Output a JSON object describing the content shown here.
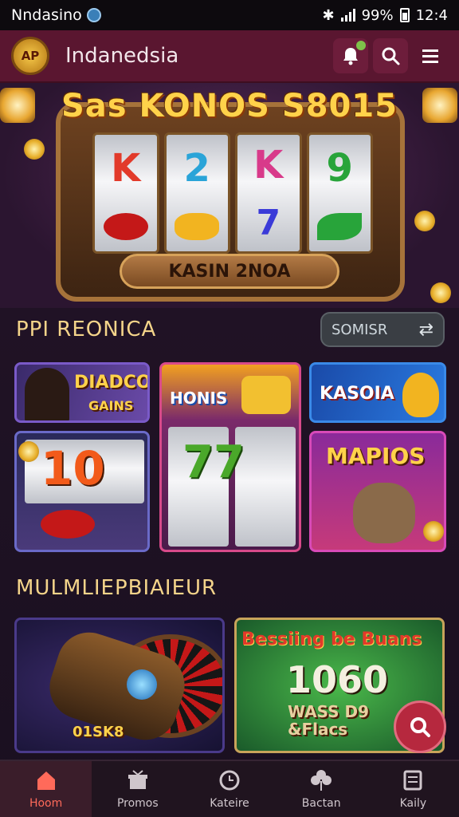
{
  "status_bar": {
    "carrier": "Nndasino",
    "battery": "99%",
    "time": "12:4"
  },
  "header": {
    "logo_text": "AP",
    "title": "Indanedsia"
  },
  "hero": {
    "title": "Sas KONOS S8015",
    "reel_symbols": [
      "K",
      "2",
      "K",
      "9"
    ],
    "plaque": "KASIN 2NOA"
  },
  "section_popular": {
    "title": "PPI REONICA",
    "sort_label": "SOMISR",
    "tiles": [
      {
        "label": "DIADCO",
        "sub": "GAINS"
      },
      {
        "label": "HONIS"
      },
      {
        "label": "KASOIA"
      },
      {
        "label": "10"
      },
      {
        "label": "77"
      },
      {
        "label": "MAPIOS"
      }
    ]
  },
  "section_multiplayer": {
    "title": "MULMLIEPBIAIEUR",
    "tiles": [
      {
        "label": "01SK8"
      },
      {
        "label": "Bessiing be Buans",
        "big": "1060",
        "sub": "WASS D9 &Flacs"
      }
    ]
  },
  "bottom_nav": [
    {
      "label": "Hoom",
      "icon": "home-icon",
      "active": true
    },
    {
      "label": "Promos",
      "icon": "gift-icon"
    },
    {
      "label": "Kateire",
      "icon": "clock-icon"
    },
    {
      "label": "Bactan",
      "icon": "clover-icon"
    },
    {
      "label": "Kaily",
      "icon": "book-icon"
    }
  ],
  "colors": {
    "accent": "#5a1630",
    "gold": "#f4d48a",
    "fab": "#b6283e",
    "active_nav": "#ff6a5a"
  }
}
